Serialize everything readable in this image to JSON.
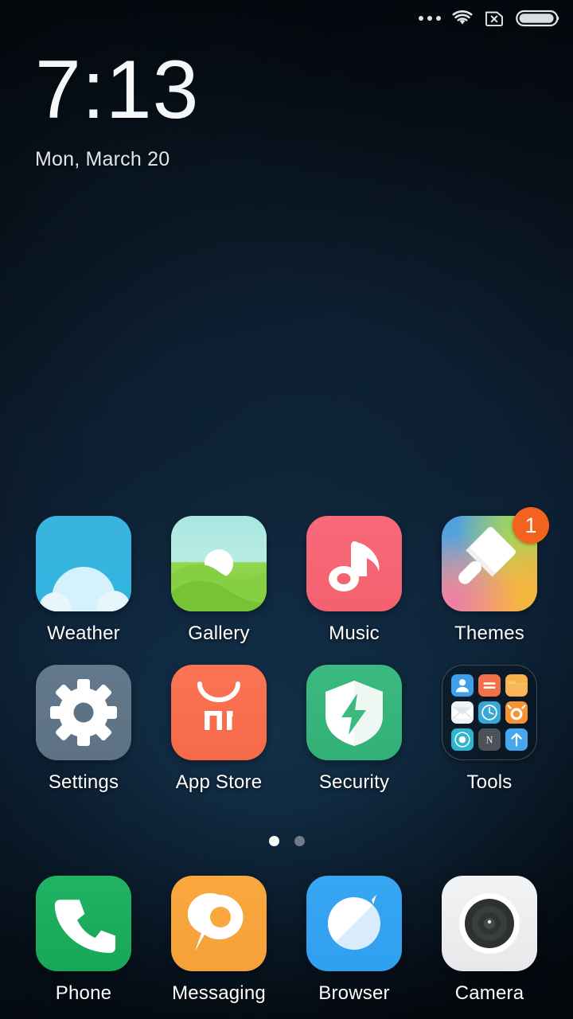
{
  "status_bar": {
    "icons": [
      {
        "name": "more-icons-icon",
        "label": "more"
      },
      {
        "name": "wifi-icon",
        "label": "Wi-Fi connected"
      },
      {
        "name": "no-sim-icon",
        "label": "No SIM card"
      },
      {
        "name": "battery-icon",
        "label": "Battery"
      }
    ],
    "battery_level_percent": 90
  },
  "clock_widget": {
    "time": "7:13",
    "date": "Mon, March 20"
  },
  "home_screen": {
    "page_indicator": {
      "total_pages": 2,
      "current_page": 1
    },
    "apps": [
      {
        "label": "Weather",
        "icon": "weather-icon",
        "badge": null
      },
      {
        "label": "Gallery",
        "icon": "gallery-icon",
        "badge": null
      },
      {
        "label": "Music",
        "icon": "music-icon",
        "badge": null
      },
      {
        "label": "Themes",
        "icon": "themes-icon",
        "badge": "1"
      },
      {
        "label": "Settings",
        "icon": "settings-icon",
        "badge": null
      },
      {
        "label": "App Store",
        "icon": "app-store-icon",
        "badge": null
      },
      {
        "label": "Security",
        "icon": "security-icon",
        "badge": null
      },
      {
        "label": "Tools",
        "icon": "tools-folder-icon",
        "badge": null
      }
    ],
    "tools_folder_contents": [
      {
        "name": "contacts-icon",
        "color": "#3f9fe8"
      },
      {
        "name": "calculator-icon",
        "color": "#f2704a"
      },
      {
        "name": "file-manager-icon",
        "color": "#f8b24c"
      },
      {
        "name": "mail-icon",
        "color": "#f2f3f5"
      },
      {
        "name": "compass-icon",
        "color": "#35a8d8"
      },
      {
        "name": "clock-icon",
        "color": "#f79232"
      },
      {
        "name": "recorder-icon",
        "color": "#2eb5cf"
      },
      {
        "name": "notes-icon",
        "color": "#4d5258"
      },
      {
        "name": "updater-icon",
        "color": "#46a6ef"
      }
    ]
  },
  "dock": {
    "apps": [
      {
        "label": "Phone",
        "icon": "phone-icon"
      },
      {
        "label": "Messaging",
        "icon": "messaging-icon"
      },
      {
        "label": "Browser",
        "icon": "browser-icon"
      },
      {
        "label": "Camera",
        "icon": "camera-icon"
      }
    ]
  },
  "colors": {
    "badge": "#f4631e",
    "label_text": "#ffffff",
    "wallpaper_base": "#0d2035"
  }
}
